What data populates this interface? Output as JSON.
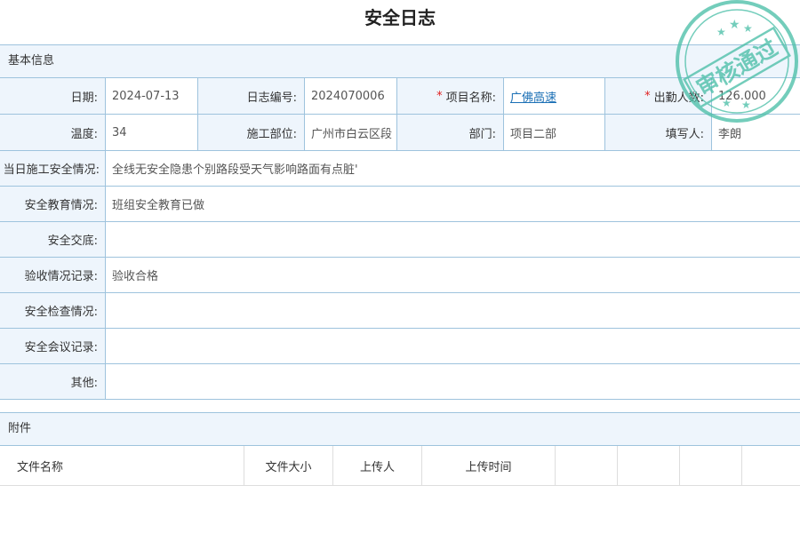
{
  "page": {
    "title": "安全日志"
  },
  "basic": {
    "header": "基本信息",
    "date_label": "日期:",
    "date_value": "2024-07-13",
    "log_no_label": "日志编号:",
    "log_no_value": "2024070006",
    "project_label": "项目名称:",
    "project_value": "广佛高速",
    "attendance_label": "出勤人数:",
    "attendance_value": "126.000",
    "temp_label": "温度:",
    "temp_value": "34",
    "site_label": "施工部位:",
    "site_value": "广州市白云区段",
    "dept_label": "部门:",
    "dept_value": "项目二部",
    "writer_label": "填写人:",
    "writer_value": "李朗",
    "required_mark": "*",
    "situation_label": "当日施工安全情况:",
    "situation_value": "全线无安全隐患个别路段受天气影响路面有点脏'",
    "education_label": "安全教育情况:",
    "education_value": "班组安全教育已做",
    "briefing_label": "安全交底:",
    "briefing_value": "",
    "acceptance_label": "验收情况记录:",
    "acceptance_value": "验收合格",
    "inspection_label": "安全检查情况:",
    "inspection_value": "",
    "meeting_label": "安全会议记录:",
    "meeting_value": "",
    "other_label": "其他:",
    "other_value": ""
  },
  "attachments": {
    "header": "附件",
    "columns": [
      "文件名称",
      "文件大小",
      "上传人",
      "上传时间",
      "",
      "",
      ""
    ]
  },
  "stamp": {
    "text": "审核通过",
    "color": "#4cbfa8"
  }
}
